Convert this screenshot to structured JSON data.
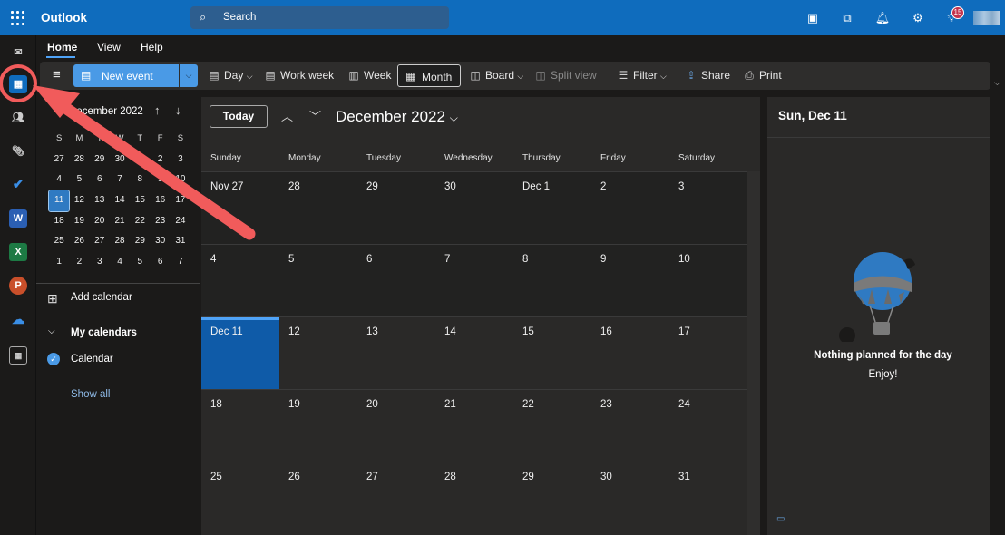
{
  "colors": {
    "brand": "#0f6cbd",
    "accent": "#4a9ae6",
    "today_cell": "#0f5ba8",
    "annotation": "#f15b5b"
  },
  "topbar": {
    "app_name": "Outlook",
    "search_placeholder": "Search",
    "notification_count": "15"
  },
  "rail": {
    "items": [
      "mail-icon",
      "calendar-icon",
      "people-icon",
      "attachment-icon",
      "todo-icon",
      "word-icon",
      "excel-icon",
      "powerpoint-icon",
      "onedrive-icon",
      "more-apps-icon"
    ],
    "word_letter": "W",
    "excel_letter": "X",
    "powerpoint_letter": "P"
  },
  "tabs": [
    "Home",
    "View",
    "Help"
  ],
  "ribbon": {
    "new_event": "New event",
    "day": "Day",
    "work_week": "Work week",
    "week": "Week",
    "month": "Month",
    "board": "Board",
    "split_view": "Split view",
    "filter": "Filter",
    "share": "Share",
    "print": "Print"
  },
  "mini_calendar": {
    "title": "December 2022",
    "weekdays": [
      "S",
      "M",
      "T",
      "W",
      "T",
      "F",
      "S"
    ],
    "weeks": [
      [
        "27",
        "28",
        "29",
        "30",
        "1",
        "2",
        "3"
      ],
      [
        "4",
        "5",
        "6",
        "7",
        "8",
        "9",
        "10"
      ],
      [
        "11",
        "12",
        "13",
        "14",
        "15",
        "16",
        "17"
      ],
      [
        "18",
        "19",
        "20",
        "21",
        "22",
        "23",
        "24"
      ],
      [
        "25",
        "26",
        "27",
        "28",
        "29",
        "30",
        "31"
      ],
      [
        "1",
        "2",
        "3",
        "4",
        "5",
        "6",
        "7"
      ]
    ]
  },
  "sidebar": {
    "add_calendar": "Add calendar",
    "my_calendars": "My calendars",
    "calendar": "Calendar",
    "show_all": "Show all"
  },
  "calendar": {
    "today_button": "Today",
    "title": "December 2022",
    "weekdays": [
      "Sunday",
      "Monday",
      "Tuesday",
      "Wednesday",
      "Thursday",
      "Friday",
      "Saturday"
    ],
    "weeks": [
      [
        "Nov 27",
        "28",
        "29",
        "30",
        "Dec 1",
        "2",
        "3"
      ],
      [
        "4",
        "5",
        "6",
        "7",
        "8",
        "9",
        "10"
      ],
      [
        "Dec 11",
        "12",
        "13",
        "14",
        "15",
        "16",
        "17"
      ],
      [
        "18",
        "19",
        "20",
        "21",
        "22",
        "23",
        "24"
      ],
      [
        "25",
        "26",
        "27",
        "28",
        "29",
        "30",
        "31"
      ]
    ]
  },
  "pane": {
    "date": "Sun, Dec 11",
    "message": "Nothing planned for the day",
    "sub": "Enjoy!"
  }
}
